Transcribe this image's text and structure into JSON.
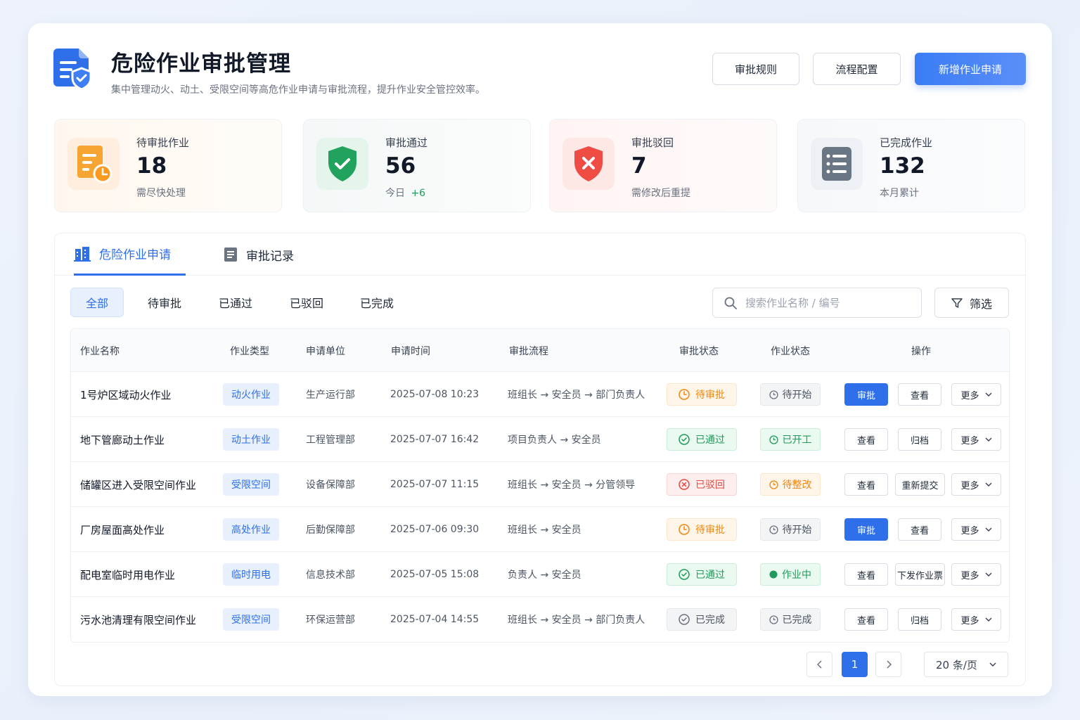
{
  "header": {
    "title": "危险作业审批管理",
    "subtitle": "集中管理动火、动土、受限空间等高危作业申请与审批流程，提升作业安全管控效率。",
    "btn_rules": "审批规则",
    "btn_flow": "流程配置",
    "btn_new": "新增作业申请"
  },
  "stats": [
    {
      "label": "待审批作业",
      "value": "18",
      "note": "需尽快处理"
    },
    {
      "label": "审批通过",
      "value": "56",
      "note": "今日",
      "delta": "+6"
    },
    {
      "label": "审批驳回",
      "value": "7",
      "note": "需修改后重提"
    },
    {
      "label": "已完成作业",
      "value": "132",
      "note": "本月累计"
    }
  ],
  "tabs": [
    "危险作业申请",
    "审批记录"
  ],
  "filters": [
    "全部",
    "待审批",
    "已通过",
    "已驳回",
    "已完成"
  ],
  "search": {
    "placeholder": "搜索作业名称 / 编号"
  },
  "filter_btn": "筛选",
  "table": {
    "headers": [
      "作业名称",
      "作业类型",
      "申请单位",
      "申请时间",
      "审批流程",
      "审批状态",
      "作业状态",
      "操作"
    ],
    "rows": [
      {
        "name": "1号炉区域动火作业",
        "type": "动火作业",
        "unit": "生产运行部",
        "time": "2025-07-08 10:23",
        "flow": "班组长 → 安全员 → 部门负责人",
        "approval": "待审批",
        "work": "待开始",
        "a1": "审批",
        "a2": "查看",
        "a3": "更多"
      },
      {
        "name": "地下管廊动土作业",
        "type": "动土作业",
        "unit": "工程管理部",
        "time": "2025-07-07 16:42",
        "flow": "项目负责人 → 安全员",
        "approval": "已通过",
        "work": "已开工",
        "a1": "查看",
        "a2": "归档",
        "a3": "更多"
      },
      {
        "name": "储罐区进入受限空间作业",
        "type": "受限空间",
        "unit": "设备保障部",
        "time": "2025-07-07 11:15",
        "flow": "班组长 → 安全员 → 分管领导",
        "approval": "已驳回",
        "work": "待整改",
        "a1": "查看",
        "a2": "重新提交",
        "a3": "更多"
      },
      {
        "name": "厂房屋面高处作业",
        "type": "高处作业",
        "unit": "后勤保障部",
        "time": "2025-07-06 09:30",
        "flow": "班组长 → 安全员",
        "approval": "待审批",
        "work": "待开始",
        "a1": "审批",
        "a2": "查看",
        "a3": "更多"
      },
      {
        "name": "配电室临时用电作业",
        "type": "临时用电",
        "unit": "信息技术部",
        "time": "2025-07-05 15:08",
        "flow": "负责人 → 安全员",
        "approval": "已通过",
        "work": "作业中",
        "a1": "查看",
        "a2": "下发作业票",
        "a3": "更多"
      },
      {
        "name": "污水池清理有限空间作业",
        "type": "受限空间",
        "unit": "环保运营部",
        "time": "2025-07-04 14:55",
        "flow": "班组长 → 安全员 → 部门负责人",
        "approval": "已完成",
        "work": "已完成",
        "a1": "查看",
        "a2": "归档",
        "a3": "更多"
      }
    ]
  },
  "pagination": {
    "current": "1",
    "page_size": "20 条/页"
  },
  "colors": {
    "primary": "#2f6fea",
    "pending": "#f0870c",
    "success": "#1e9a5a",
    "danger": "#e5483f"
  }
}
